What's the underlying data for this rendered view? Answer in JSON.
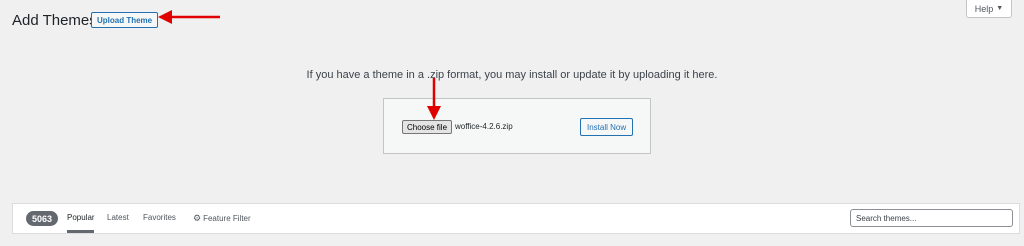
{
  "header": {
    "title": "Add Themes",
    "upload_label": "Upload Theme",
    "help_label": "Help",
    "help_caret": "▼"
  },
  "upload": {
    "instructions": "If you have a theme in a .zip format, you may install or update it by uploading it here.",
    "choose_label": "Choose file",
    "file_name": "woffice-4.2.6.zip",
    "install_label": "Install Now"
  },
  "filter": {
    "count": "5063",
    "tabs": [
      {
        "label": "Popular",
        "active": true
      },
      {
        "label": "Latest",
        "active": false
      },
      {
        "label": "Favorites",
        "active": false
      }
    ],
    "feature_filter_label": "Feature Filter",
    "search_placeholder": "Search themes..."
  },
  "colors": {
    "accent": "#2271b1",
    "annotation_arrow": "#e00000"
  },
  "icons": {
    "feature_filter": "gear-icon"
  }
}
